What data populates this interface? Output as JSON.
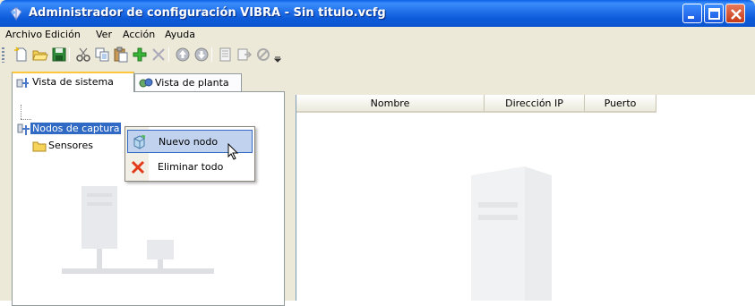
{
  "window": {
    "title": "Administrador de configuración VIBRA - Sin titulo.vcfg",
    "buttons": [
      "minimize",
      "maximize",
      "close"
    ]
  },
  "menu": {
    "items": [
      "Archivo",
      "Edición",
      "Ver",
      "Acción",
      "Ayuda"
    ]
  },
  "toolbar": {
    "icons": [
      "new-file-icon",
      "open-folder-icon",
      "save-icon",
      "cut-icon",
      "copy-icon",
      "paste-icon",
      "add-icon",
      "delete-icon",
      "move-up-icon",
      "move-down-icon",
      "properties-icon",
      "export-icon",
      "disable-icon",
      "overflow-icon"
    ]
  },
  "tabs": [
    {
      "label": "Vista de sistema",
      "active": true
    },
    {
      "label": "Vista de planta",
      "active": false
    }
  ],
  "tree": {
    "nodes": [
      {
        "label": "Nodos de captura",
        "visible_label": "Nodos de cap",
        "selected": true
      },
      {
        "label": "Sensores",
        "selected": false
      }
    ]
  },
  "context_menu": {
    "items": [
      {
        "label": "Nuevo nodo",
        "icon": "new-node-icon",
        "hover": true
      },
      {
        "label": "Eliminar todo",
        "icon": "delete-all-icon",
        "hover": false
      }
    ]
  },
  "list": {
    "columns": [
      "Nombre",
      "Dirección IP",
      "Puerto"
    ]
  },
  "colors": {
    "titlebar": "#0b54d0",
    "selection": "#316ac5",
    "tab_highlight": "#ffc83c",
    "chrome": "#ece9d8"
  }
}
